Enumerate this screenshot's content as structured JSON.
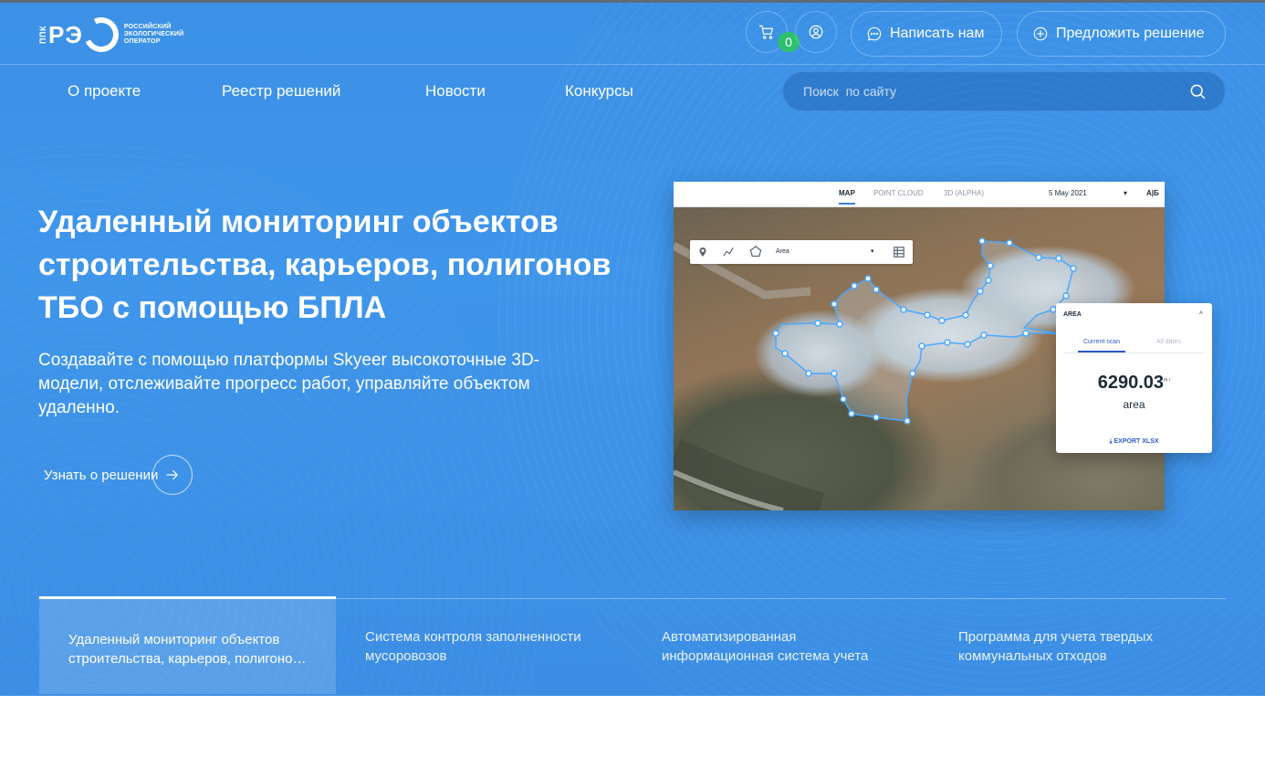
{
  "header": {
    "logo": {
      "abbr": "ППК",
      "r": "Р",
      "e": "Э",
      "line1": "РОССИЙСКИЙ",
      "line2": "ЭКОЛОГИЧЕСКИЙ",
      "line3": "ОПЕРАТОР"
    },
    "cart_count": "0",
    "write_label": "Написать нам",
    "suggest_label": "Предложить решение"
  },
  "nav": {
    "items": [
      {
        "label": "О проекте"
      },
      {
        "label": "Реестр решений"
      },
      {
        "label": "Новости"
      },
      {
        "label": "Конкурсы"
      }
    ]
  },
  "search": {
    "placeholder": "Поиск  по сайту"
  },
  "hero": {
    "title": "Удаленный мониторинг объектов строительства, карьеров, полигонов ТБО с помощью БПЛА",
    "description": "Создавайте с помощью платформы Skyeer высокоточные 3D-модели, отслеживайте прогресс работ, управляйте объектом удаленно.",
    "link_label": "Узнать о решении"
  },
  "app_preview": {
    "tabs": [
      "MAP",
      "POINT CLOUD",
      "3D (ALPHA)"
    ],
    "date": "5 May 2021",
    "ab": "A|Б",
    "tool_select": "Area",
    "panel": {
      "title": "AREA",
      "tab_current": "Current scan",
      "tab_all": "All dates",
      "value": "6290.03",
      "unit": "m ²",
      "label": "area",
      "export": "EXPORT XLSX"
    }
  },
  "bottom_tabs": [
    {
      "label": "Удаленный мониторинг объектов строительства, карьеров, полигонов ТБО с помощью БПЛА"
    },
    {
      "label": "Система контроля заполненности мусоровозов"
    },
    {
      "label": "Автоматизированная информационная система учета"
    },
    {
      "label": "Программа для учета твердых коммунальных отходов"
    }
  ],
  "colors": {
    "hero_bg": "#3c91e6",
    "badge": "#2fbf6e",
    "polygon": "#4aa8ff"
  }
}
